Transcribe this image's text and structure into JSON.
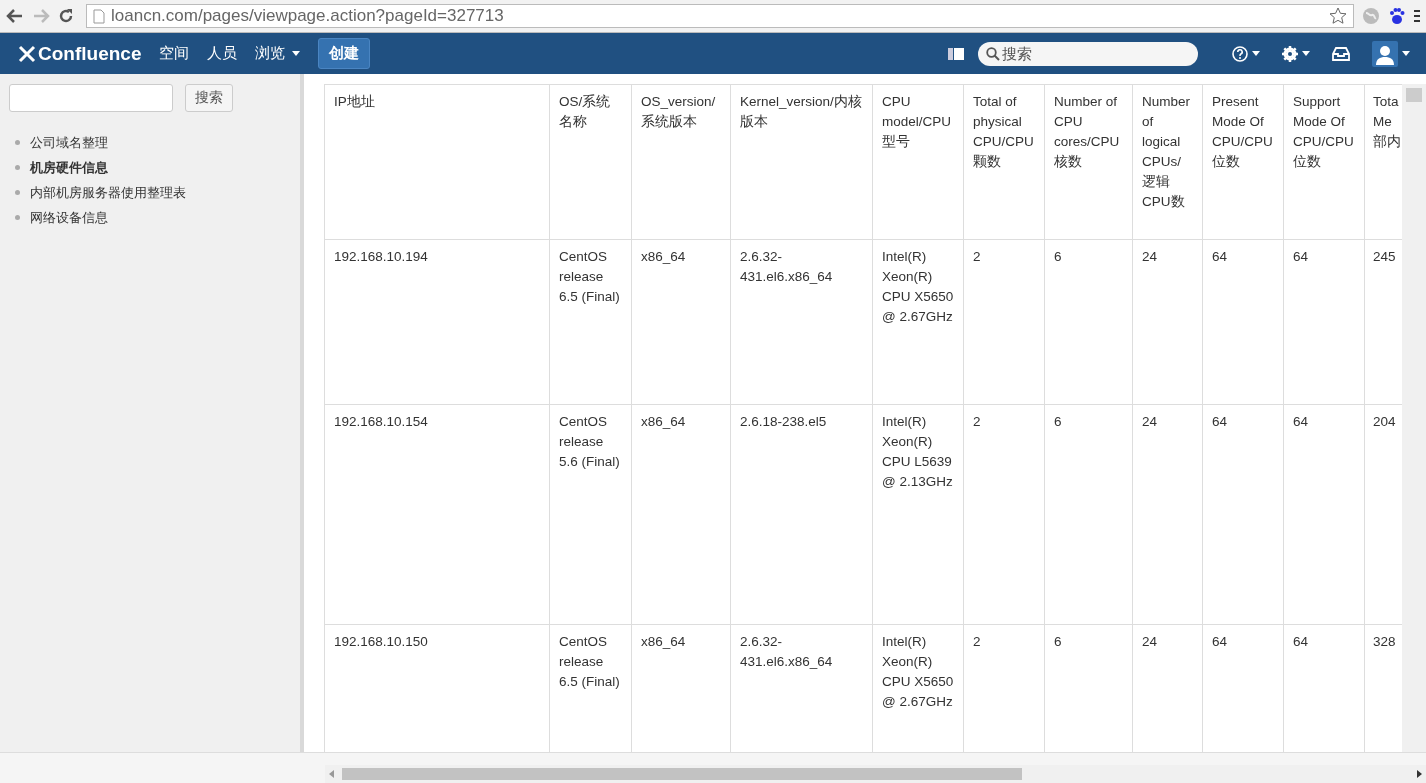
{
  "browser": {
    "url": "loancn.com/pages/viewpage.action?pageId=327713"
  },
  "header": {
    "logo": "Confluence",
    "nav": [
      {
        "label": "空间",
        "dropdown": false
      },
      {
        "label": "人员",
        "dropdown": false
      },
      {
        "label": "浏览",
        "dropdown": true
      }
    ],
    "create": "创建",
    "search": {
      "placeholder": "搜索"
    }
  },
  "sidebar": {
    "search_button": "搜索",
    "items": [
      {
        "label": "公司域名整理",
        "selected": false
      },
      {
        "label": "机房硬件信息",
        "selected": true
      },
      {
        "label": "内部机房服务器使用整理表",
        "selected": false
      },
      {
        "label": "网络设备信息",
        "selected": false
      }
    ]
  },
  "table": {
    "columns": [
      "IP地址",
      "OS/系统名称",
      "OS_version/系统版本",
      "Kernel_version/内核版本",
      "CPU model/CPU型号",
      "Total of physical CPU/CPU颗数",
      "Number of CPU cores/CPU核数",
      "Number of logical CPUs/逻辑CPU数",
      "Present Mode Of CPU/CPU位数",
      "Support Mode Of CPU/CPU位数",
      "Tota Me 部内"
    ],
    "rows": [
      [
        "192.168.10.194",
        "CentOS release 6.5 (Final)",
        "x86_64",
        "2.6.32-431.el6.x86_64",
        "Intel(R) Xeon(R) CPU X5650 @ 2.67GHz",
        "2",
        "6",
        "24",
        "64",
        "64",
        "245"
      ],
      [
        "192.168.10.154",
        "CentOS release 5.6 (Final)",
        "x86_64",
        "2.6.18-238.el5",
        "Intel(R) Xeon(R) CPU L5639 @ 2.13GHz",
        "2",
        "6",
        "24",
        "64",
        "64",
        "204"
      ],
      [
        "192.168.10.150",
        "CentOS release 6.5 (Final)",
        "x86_64",
        "2.6.32-431.el6.x86_64",
        "Intel(R) Xeon(R) CPU X5650 @ 2.67GHz",
        "2",
        "6",
        "24",
        "64",
        "64",
        "328"
      ]
    ]
  }
}
